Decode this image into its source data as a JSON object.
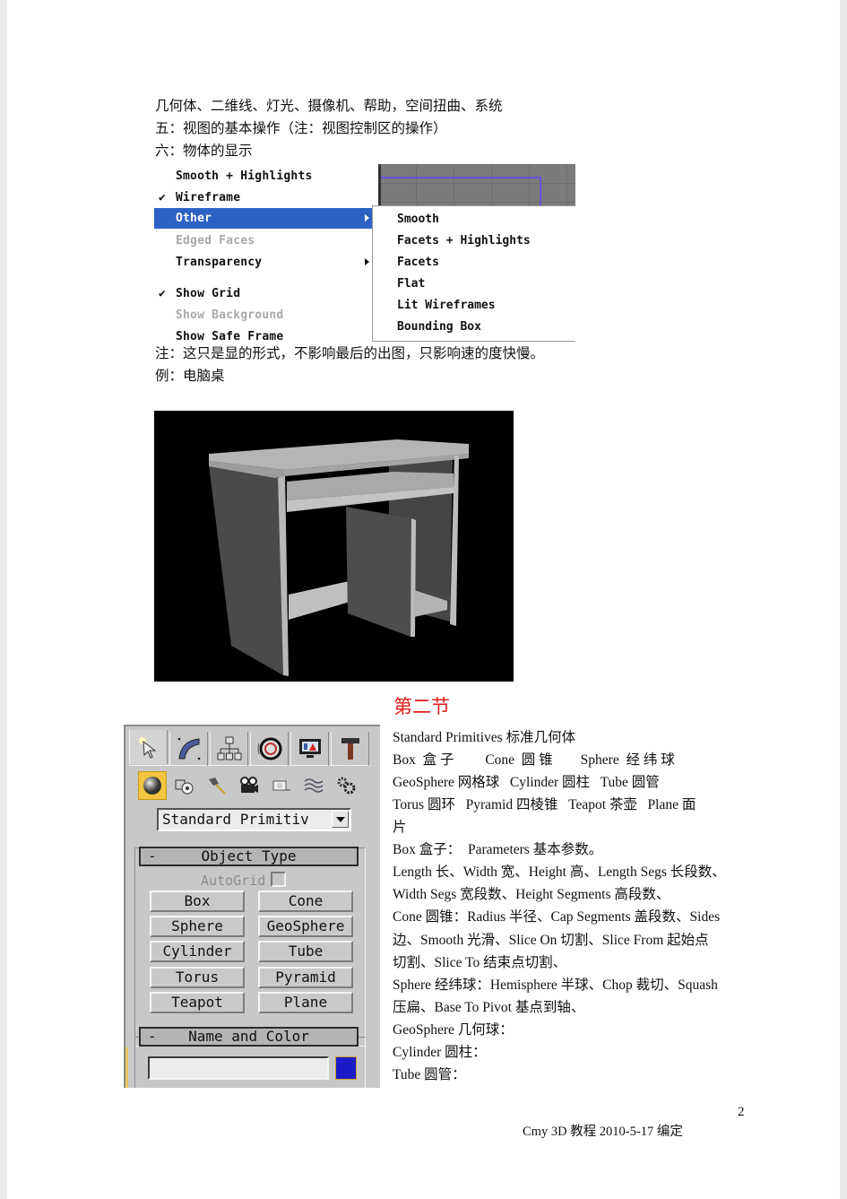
{
  "document": {
    "intro_lines": [
      "几何体、二维线、灯光、摄像机、帮助，空间扭曲、系统",
      "五：视图的基本操作（注：视图控制区的操作）",
      "六：物体的显示"
    ],
    "display_menu": {
      "items": [
        {
          "label": "Smooth + Highlights",
          "checked": false,
          "disabled": false,
          "submenu": false,
          "active": false
        },
        {
          "label": "Wireframe",
          "checked": true,
          "disabled": false,
          "submenu": false,
          "active": false
        },
        {
          "label": "Other",
          "checked": false,
          "disabled": false,
          "submenu": true,
          "active": true
        },
        {
          "label": "Edged Faces",
          "checked": false,
          "disabled": true,
          "submenu": false,
          "active": false
        },
        {
          "label": "Transparency",
          "checked": false,
          "disabled": false,
          "submenu": true,
          "active": false
        },
        {
          "label": "Show Grid",
          "checked": true,
          "disabled": false,
          "submenu": false,
          "active": false
        },
        {
          "label": "Show Background",
          "checked": false,
          "disabled": true,
          "submenu": false,
          "active": false
        },
        {
          "label": "Show Safe Frame",
          "checked": false,
          "disabled": false,
          "submenu": false,
          "active": false
        }
      ],
      "check_glyph": "✔",
      "submenu_items": [
        "Smooth",
        "Facets + Highlights",
        "Facets",
        "Flat",
        "Lit Wireframes",
        "Bounding Box"
      ],
      "highlight_color": "#2d62c4"
    },
    "note_lines": [
      "注：这只是显的形式，不影响最后的出图，只影响速的度快慢。",
      "例：电脑桌"
    ],
    "render_caption": "computer-desk-render",
    "section_title": "第二节",
    "section_title_color": "#e11b1b",
    "create_panel": {
      "tabs": [
        "create-icon",
        "modify-icon",
        "hierarchy-icon",
        "motion-icon",
        "display-icon",
        "utilities-icon"
      ],
      "categories": [
        "geometry-icon",
        "shapes-icon",
        "lights-icon",
        "cameras-icon",
        "helpers-icon",
        "space-warps-icon",
        "systems-icon"
      ],
      "dropdown_value": "Standard Primitiv",
      "object_type": {
        "title": "Object Type",
        "collapse": "-",
        "autogrid_label": "AutoGrid",
        "buttons": [
          "Box",
          "Cone",
          "Sphere",
          "GeoSphere",
          "Cylinder",
          "Tube",
          "Torus",
          "Pyramid",
          "Teapot",
          "Plane"
        ]
      },
      "name_and_color": {
        "title": "Name and Color",
        "collapse": "-",
        "name_value": "",
        "color": "#1a1ac8"
      }
    },
    "right_lines": [
      "Standard Primitives 标准几何体",
      "Box  盒 子         Cone  圆 锥        Sphere  经 纬 球",
      "GeoSphere 网格球   Cylinder 圆柱   Tube 圆管",
      "Torus 圆环   Pyramid 四棱锥   Teapot 茶壶   Plane 面",
      "片",
      "Box 盒子：  Parameters 基本参数。",
      "Length 长、Width 宽、Height 高、Length Segs 长段数、",
      "Width Segs 宽段数、Height Segments 高段数、",
      "Cone 圆锥：Radius 半径、Cap Segments 盖段数、Sides",
      "边、Smooth 光滑、Slice On 切割、Slice From 起始点",
      "切割、Slice To 结束点切割、",
      "Sphere 经纬球：Hemisphere 半球、Chop 裁切、Squash",
      "压扁、Base To Pivot 基点到轴、",
      "GeoSphere 几何球：",
      "Cylinder 圆柱：",
      "Tube 圆管："
    ],
    "page_number": "2",
    "footer": "Cmy 3D 教程    2010-5-17 编定"
  }
}
